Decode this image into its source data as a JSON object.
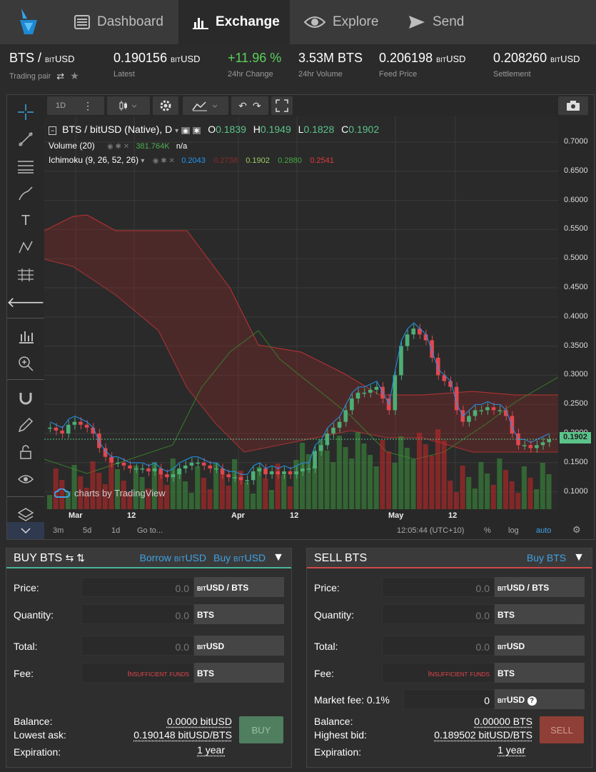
{
  "nav": {
    "tabs": [
      {
        "label": "Dashboard",
        "icon": "dashboard-icon"
      },
      {
        "label": "Exchange",
        "icon": "chart-icon",
        "active": true
      },
      {
        "label": "Explore",
        "icon": "eye-icon"
      },
      {
        "label": "Send",
        "icon": "send-icon"
      }
    ]
  },
  "stats": {
    "pair": "BTS / ",
    "pair_unit": "bitUSD",
    "pair_label": "Trading pair",
    "latest": "0.190156",
    "latest_unit": "bitUSD",
    "latest_label": "Latest",
    "change": "+11.96 %",
    "change_label": "24hr Change",
    "volume": "3.53M BTS",
    "volume_label": "24hr Volume",
    "feed": "0.206198",
    "feed_unit": "bitUSD",
    "feed_label": "Feed Price",
    "settlement": "0.208260",
    "settlement_unit": "bitUSD",
    "settlement_label": "Settlement",
    "change_color": "#5bd15b"
  },
  "chart": {
    "interval": "1D",
    "title": "BTS / bitUSD (Native), D",
    "ohlc": {
      "o_label": "O",
      "o": "0.1839",
      "h_label": "H",
      "h": "0.1949",
      "l_label": "L",
      "l": "0.1828",
      "c_label": "C",
      "c": "0.1902"
    },
    "volume_label": "Volume (20)",
    "volume_value": "381.764K",
    "volume_na": "n/a",
    "ichimoku_label": "Ichimoku (9, 26, 52, 26)",
    "ichimoku_values": [
      "0.2043",
      "0.2738",
      "0.1902",
      "0.2880",
      "0.2541"
    ],
    "ichimoku_colors": [
      "#2196f3",
      "#e33a3a",
      "#9ccc65",
      "#44aa44",
      "#e33a3a"
    ],
    "watermark": "charts by TradingView",
    "last_price_tag": "0.1902",
    "time": "12:05:44 (UTC+10)",
    "ranges": [
      "3m",
      "5d",
      "1d",
      "Go to..."
    ],
    "opts": [
      "%",
      "log",
      "auto"
    ]
  },
  "chart_data": {
    "type": "candlestick",
    "title": "BTS / bitUSD (Native), D",
    "y_ticks": [
      "0.7000",
      "0.6500",
      "0.6000",
      "0.5500",
      "0.5000",
      "0.4500",
      "0.4000",
      "0.3500",
      "0.3000",
      "0.2500",
      "0.2000",
      "0.1500",
      "0.1000"
    ],
    "x_ticks": [
      "Mar",
      "12",
      "Apr",
      "12",
      "May",
      "12"
    ],
    "ylim": [
      0.07,
      0.72
    ],
    "close_series": [
      0.21,
      0.205,
      0.2,
      0.215,
      0.22,
      0.215,
      0.21,
      0.2,
      0.175,
      0.16,
      0.15,
      0.15,
      0.145,
      0.14,
      0.14,
      0.14,
      0.135,
      0.14,
      0.13,
      0.125,
      0.13,
      0.14,
      0.145,
      0.15,
      0.15,
      0.145,
      0.14,
      0.14,
      0.13,
      0.125,
      0.125,
      0.12,
      0.12,
      0.135,
      0.14,
      0.13,
      0.135,
      0.13,
      0.135,
      0.13,
      0.135,
      0.14,
      0.14,
      0.17,
      0.18,
      0.2,
      0.21,
      0.22,
      0.24,
      0.26,
      0.27,
      0.27,
      0.275,
      0.28,
      0.26,
      0.24,
      0.3,
      0.35,
      0.37,
      0.38,
      0.37,
      0.36,
      0.33,
      0.3,
      0.29,
      0.28,
      0.24,
      0.22,
      0.23,
      0.24,
      0.24,
      0.245,
      0.24,
      0.24,
      0.23,
      0.2,
      0.18,
      0.18,
      0.175,
      0.18,
      0.185,
      0.19
    ],
    "last": 0.1902
  },
  "buy": {
    "title": "BUY BTS",
    "links": [
      "Borrow ",
      "Buy "
    ],
    "link_unit": "bitUSD",
    "price_label": "Price:",
    "quantity_label": "Quantity:",
    "total_label": "Total:",
    "fee_label": "Fee:",
    "price": "0.0",
    "quantity": "0.0",
    "total": "0.0",
    "fee_warning": "Insufficient funds",
    "price_unit": "bitUSD / BTS",
    "quantity_unit": "BTS",
    "total_unit": "bitUSD",
    "fee_unit": "BTS",
    "balance_label": "Balance:",
    "balance": "0.0000 bitUSD",
    "best_label": "Lowest ask:",
    "best": "0.190148 bitUSD/BTS",
    "expiration_label": "Expiration:",
    "expiration": "1 year",
    "action": "BUY"
  },
  "sell": {
    "title": "SELL BTS",
    "links": [
      "Buy BTS"
    ],
    "price_label": "Price:",
    "quantity_label": "Quantity:",
    "total_label": "Total:",
    "fee_label": "Fee:",
    "price": "0.0",
    "quantity": "0.0",
    "total": "0.0",
    "fee_warning": "Insufficient funds",
    "price_unit": "bitUSD / BTS",
    "quantity_unit": "BTS",
    "total_unit": "bitUSD",
    "fee_unit": "BTS",
    "market_fee_label": "Market fee: 0.1%",
    "market_fee": "0",
    "market_fee_unit": "bitUSD",
    "balance_label": "Balance:",
    "balance": "0.00000 BTS",
    "best_label": "Highest bid:",
    "best": "0.189502 bitUSD/BTS",
    "expiration_label": "Expiration:",
    "expiration": "1 year",
    "action": "SELL"
  }
}
